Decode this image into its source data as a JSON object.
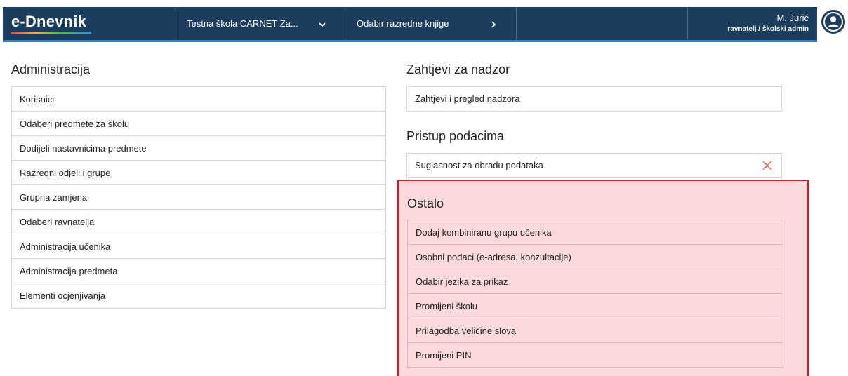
{
  "header": {
    "brand": "e-Dnevnik",
    "school": "Testna škola CARNET Za...",
    "classbook": "Odabir razredne knjige",
    "user_name": "M. Jurić",
    "user_role": "ravnatelj / školski admin",
    "icons": [
      "chevron-down-icon",
      "chevron-right-icon",
      "user-icon"
    ]
  },
  "administracija": {
    "title": "Administracija",
    "items": [
      "Korisnici",
      "Odaberi predmete za školu",
      "Dodijeli nastavnicima predmete",
      "Razredni odjeli i grupe",
      "Grupna zamjena",
      "Odaberi ravnatelja",
      "Administracija učenika",
      "Administracija predmeta",
      "Elementi ocjenjivanja"
    ]
  },
  "nadzor": {
    "title": "Zahtjevi za nadzor",
    "item": "Zahtjevi i pregled nadzora"
  },
  "pristup": {
    "title": "Pristup podacima",
    "item": "Suglasnost za obradu podataka",
    "icon": "close-icon"
  },
  "ostalo": {
    "title": "Ostalo",
    "items": [
      "Dodaj kombiniranu grupu učenika",
      "Osobni podaci (e-adresa, konzultacije)",
      "Odabir jezika za prikaz",
      "Promijeni školu",
      "Prilagodba veličine slova",
      "Promijeni PIN"
    ]
  },
  "colors": {
    "navbar": "#1d3d5f",
    "navbar_underline": "#2e7fc1",
    "highlight_bg": "#fcd9da",
    "highlight_border": "#e0121b",
    "close_icon": "#e05050"
  }
}
